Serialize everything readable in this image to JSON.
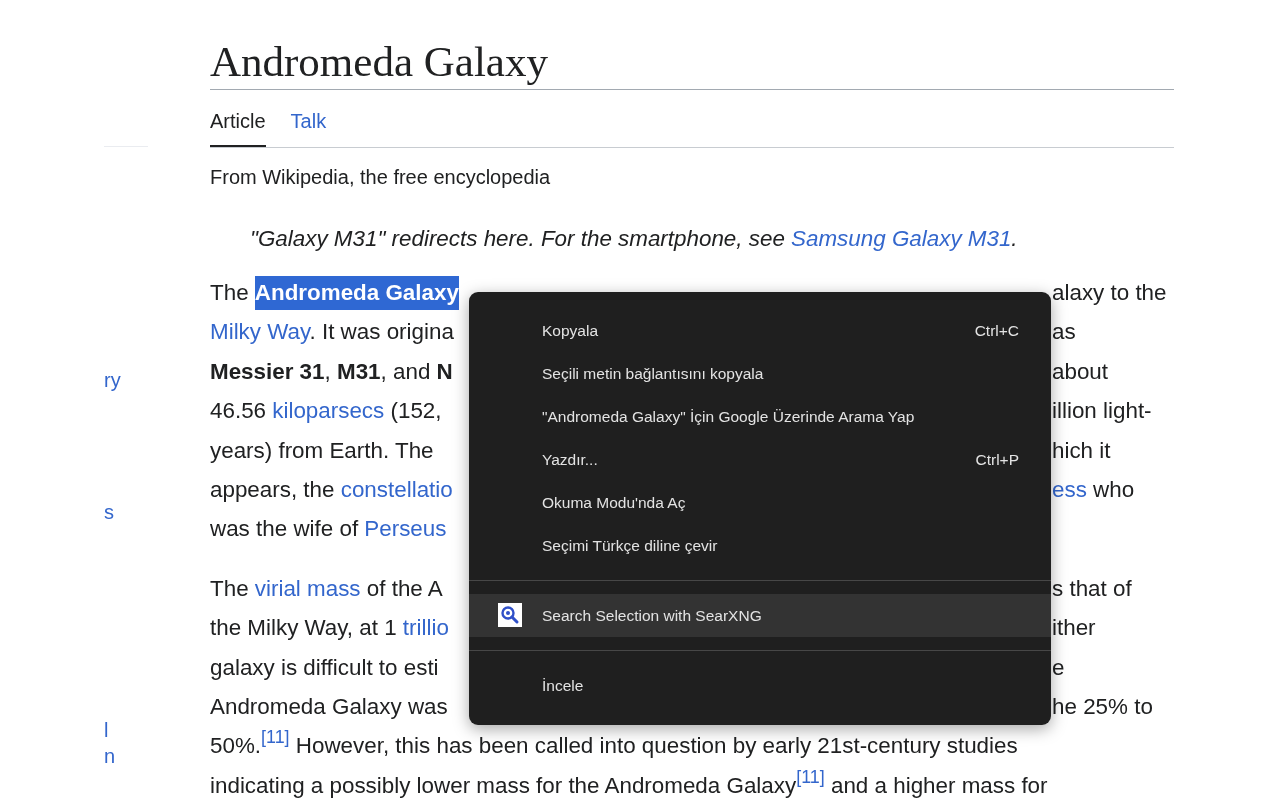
{
  "sidebar": {
    "fragments": [
      "ry",
      "s",
      "l",
      "n"
    ]
  },
  "title": "Andromeda Galaxy",
  "tabs": [
    {
      "label": "Article",
      "selected": true
    },
    {
      "label": "Talk",
      "selected": false
    }
  ],
  "tagline": "From Wikipedia, the free encyclopedia",
  "hatnote": [
    {
      "kind": "plain",
      "text": "\"Galaxy M31\" redirects here. For the smartphone, see "
    },
    {
      "kind": "link",
      "text": "Samsung Galaxy M31"
    },
    {
      "kind": "plain",
      "text": "."
    }
  ],
  "paragraphs": [
    [
      {
        "left": [
          {
            "kind": "plain",
            "text": "The "
          },
          {
            "kind": "selected",
            "text": "Andromeda Galaxy"
          }
        ],
        "right": [
          {
            "kind": "plain",
            "text": "alaxy to the"
          }
        ]
      },
      {
        "left": [
          {
            "kind": "link",
            "text": "Milky Way"
          },
          {
            "kind": "plain",
            "text": ". It was origina"
          }
        ],
        "right": [
          {
            "kind": "plain",
            "text": "as"
          }
        ]
      },
      {
        "left": [
          {
            "kind": "bold",
            "text": "Messier 31"
          },
          {
            "kind": "plain",
            "text": ", "
          },
          {
            "kind": "bold",
            "text": "M31"
          },
          {
            "kind": "plain",
            "text": ", and "
          },
          {
            "kind": "bold",
            "text": "N"
          }
        ],
        "right": [
          {
            "kind": "plain",
            "text": " about"
          }
        ]
      },
      {
        "left": [
          {
            "kind": "plain",
            "text": "46.56 "
          },
          {
            "kind": "link",
            "text": "kiloparsecs"
          },
          {
            "kind": "plain",
            "text": " (152,"
          }
        ],
        "right": [
          {
            "kind": "plain",
            "text": "illion light-"
          }
        ]
      },
      {
        "left": [
          {
            "kind": "plain",
            "text": "years) from Earth. The"
          }
        ],
        "right": [
          {
            "kind": "plain",
            "text": "hich it"
          }
        ]
      },
      {
        "left": [
          {
            "kind": "plain",
            "text": "appears, the "
          },
          {
            "kind": "link",
            "text": "constellatio"
          }
        ],
        "right": [
          {
            "kind": "link",
            "text": "ess"
          },
          {
            "kind": "plain",
            "text": " who"
          }
        ]
      },
      {
        "left": [
          {
            "kind": "plain",
            "text": "was the wife of "
          },
          {
            "kind": "link",
            "text": "Perseus"
          }
        ]
      }
    ],
    [
      {
        "left": [
          {
            "kind": "plain",
            "text": "The "
          },
          {
            "kind": "link",
            "text": "virial mass"
          },
          {
            "kind": "plain",
            "text": " of the A"
          }
        ],
        "right": [
          {
            "kind": "plain",
            "text": "s that of"
          }
        ]
      },
      {
        "left": [
          {
            "kind": "plain",
            "text": "the Milky Way, at 1 "
          },
          {
            "kind": "link",
            "text": "trillio"
          }
        ],
        "right": [
          {
            "kind": "plain",
            "text": "ither"
          }
        ]
      },
      {
        "left": [
          {
            "kind": "plain",
            "text": "galaxy is difficult to esti"
          }
        ],
        "right": [
          {
            "kind": "plain",
            "text": "e"
          }
        ]
      },
      {
        "left": [
          {
            "kind": "plain",
            "text": "Andromeda Galaxy was"
          }
        ],
        "right": [
          {
            "kind": "plain",
            "text": "he 25% to"
          }
        ]
      },
      {
        "left": [
          {
            "kind": "plain",
            "text": "50%."
          },
          {
            "kind": "cite",
            "text": "[11]"
          },
          {
            "kind": "plain",
            "text": " However, this has been called into question by early 21st-century studies"
          }
        ]
      },
      {
        "left": [
          {
            "kind": "plain",
            "text": "indicating a possibly lower mass for the Andromeda Galaxy"
          },
          {
            "kind": "cite",
            "text": "[11]"
          },
          {
            "kind": "plain",
            "text": " and a higher mass for"
          }
        ]
      }
    ]
  ],
  "context_menu": {
    "items": [
      {
        "kind": "item",
        "label": "Kopyala",
        "shortcut": "Ctrl+C",
        "highlighted": false
      },
      {
        "kind": "item",
        "label": "Seçili metin bağlantısını kopyala",
        "highlighted": false
      },
      {
        "kind": "item",
        "label": "\"Andromeda Galaxy\" İçin Google Üzerinde Arama Yap",
        "highlighted": false
      },
      {
        "kind": "item",
        "label": "Yazdır...",
        "shortcut": "Ctrl+P",
        "highlighted": false
      },
      {
        "kind": "item",
        "label": "Okuma Modu'nda Aç",
        "highlighted": false
      },
      {
        "kind": "item",
        "label": "Seçimi Türkçe diline çevir",
        "highlighted": false
      },
      {
        "kind": "separator"
      },
      {
        "kind": "extension",
        "label": "Search Selection with SearXNG",
        "highlighted": true
      },
      {
        "kind": "separator"
      },
      {
        "kind": "item",
        "label": "İncele",
        "highlighted": false
      }
    ]
  }
}
